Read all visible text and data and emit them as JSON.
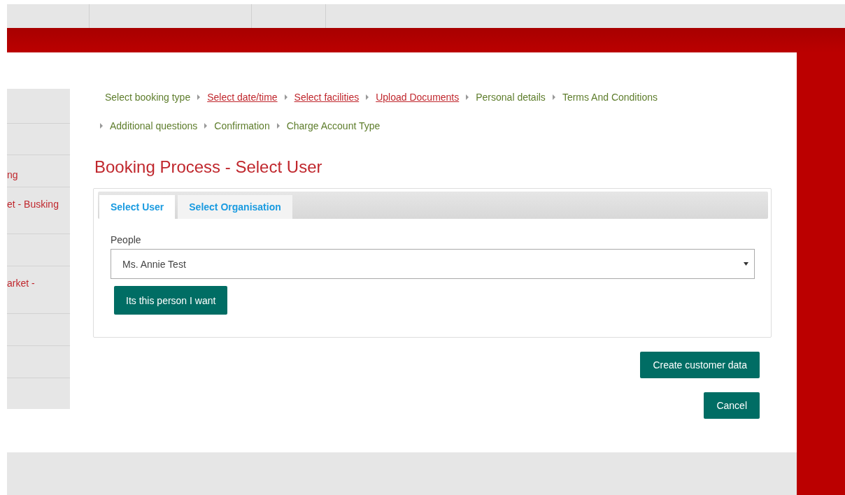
{
  "sidebar": {
    "items": [
      {
        "label": "ng"
      },
      {
        "label": "et - Busking"
      },
      {
        "label": "arket -"
      }
    ]
  },
  "breadcrumb": [
    {
      "label": "Select booking type",
      "kind": "plain"
    },
    {
      "label": "Select date/time",
      "kind": "link"
    },
    {
      "label": "Select facilities",
      "kind": "link"
    },
    {
      "label": "Upload Documents",
      "kind": "link"
    },
    {
      "label": "Personal details",
      "kind": "plain"
    },
    {
      "label": "Terms And Conditions",
      "kind": "plain"
    },
    {
      "label": "Additional questions",
      "kind": "plain"
    },
    {
      "label": "Confirmation",
      "kind": "plain"
    },
    {
      "label": "Charge Account Type",
      "kind": "plain"
    }
  ],
  "title": "Booking Process - Select User",
  "tabs": [
    {
      "label": "Select User",
      "selected": true
    },
    {
      "label": "Select Organisation",
      "selected": false
    }
  ],
  "people": {
    "label": "People",
    "value": "Ms. Annie Test"
  },
  "confirm_button": "Its this person I want",
  "buttons": [
    "Create customer data",
    "Cancel"
  ]
}
